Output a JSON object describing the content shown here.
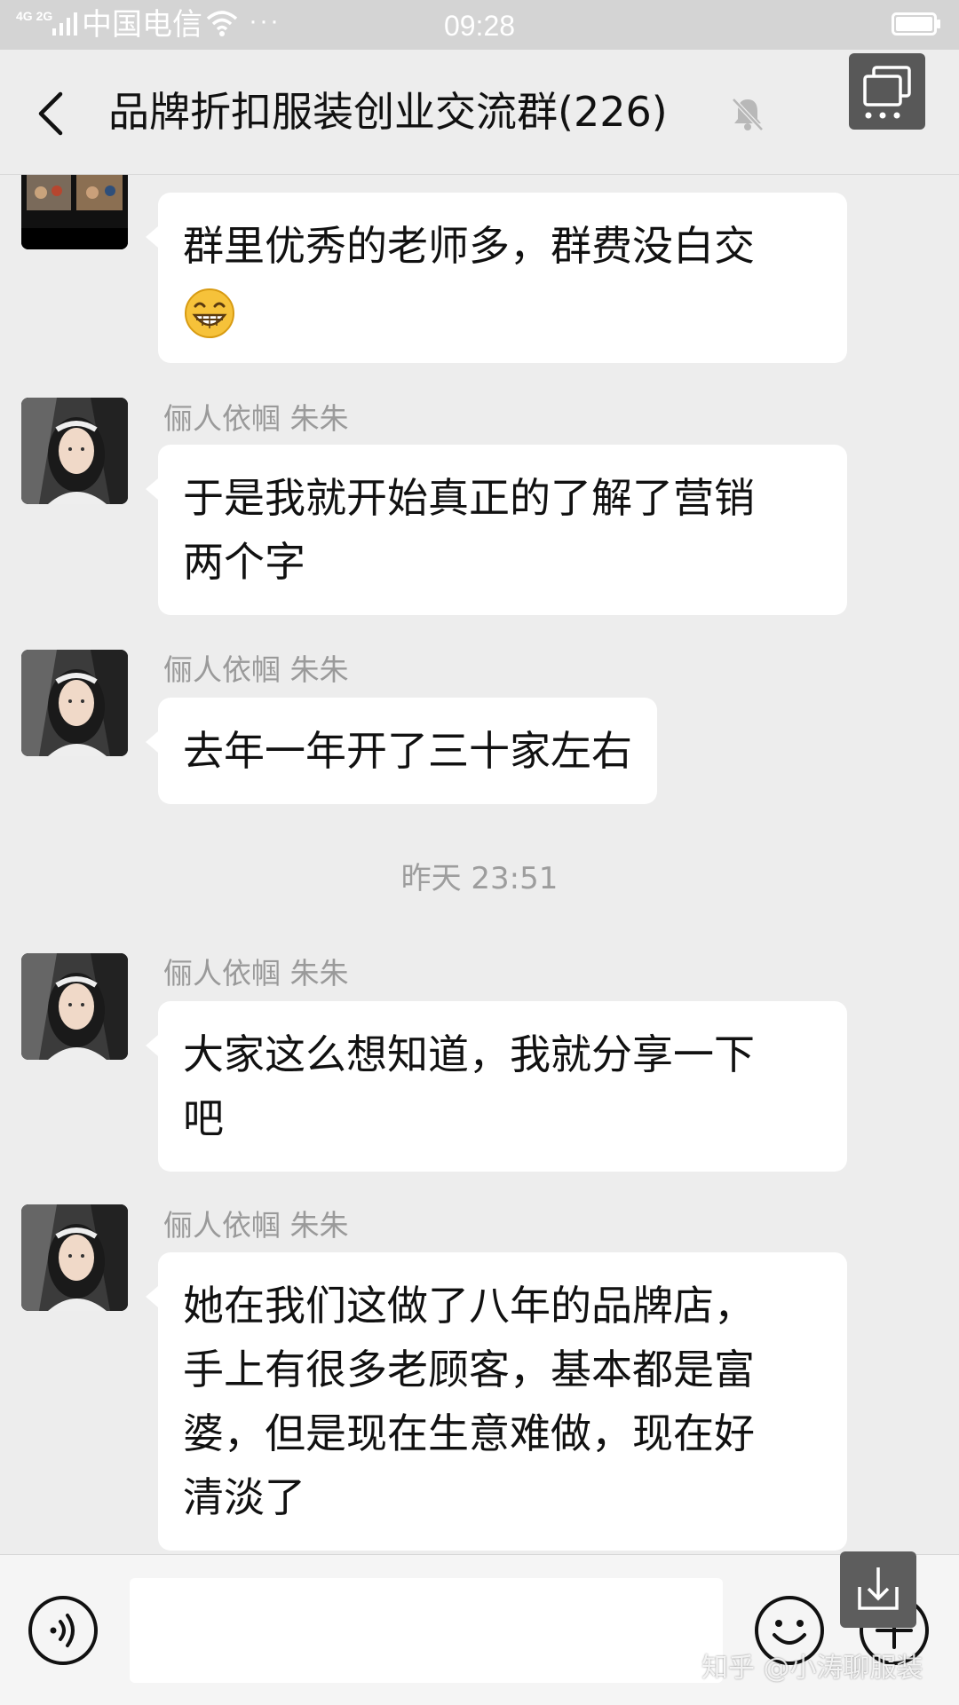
{
  "status_bar": {
    "network": "4G 2G",
    "carrier": "中国电信",
    "more": "···",
    "time": "09:28"
  },
  "header": {
    "title": "品牌折扣服装创业交流群(226)"
  },
  "messages": [
    {
      "sender": "",
      "lines": [
        "群里优秀的老师多，群费没白交"
      ],
      "emoji": "grinning-emoji"
    },
    {
      "sender": "俪人依帼 朱朱",
      "lines": [
        "于是我就开始真正的了解了营销",
        "两个字"
      ]
    },
    {
      "sender": "俪人依帼 朱朱",
      "lines": [
        "去年一年开了三十家左右"
      ]
    },
    {
      "sender": "俪人依帼 朱朱",
      "lines": [
        "大家这么想知道，我就分享一下",
        "吧"
      ]
    },
    {
      "sender": "俪人依帼 朱朱",
      "lines": [
        "她在我们这做了八年的品牌店，",
        "手上有很多老顾客，基本都是富",
        "婆，但是现在生意难做，现在好",
        "清淡了"
      ]
    }
  ],
  "timestamp": "昨天 23:51",
  "input_bar": {
    "placeholder": "",
    "icons": [
      "voice-icon",
      "emoji-icon",
      "plus-icon"
    ]
  },
  "watermark": "知乎 @小涛聊服装",
  "colors": {
    "background": "#ededed",
    "bubble": "#ffffff",
    "sender_text": "#9a9a9a",
    "header_button": "#585858"
  }
}
